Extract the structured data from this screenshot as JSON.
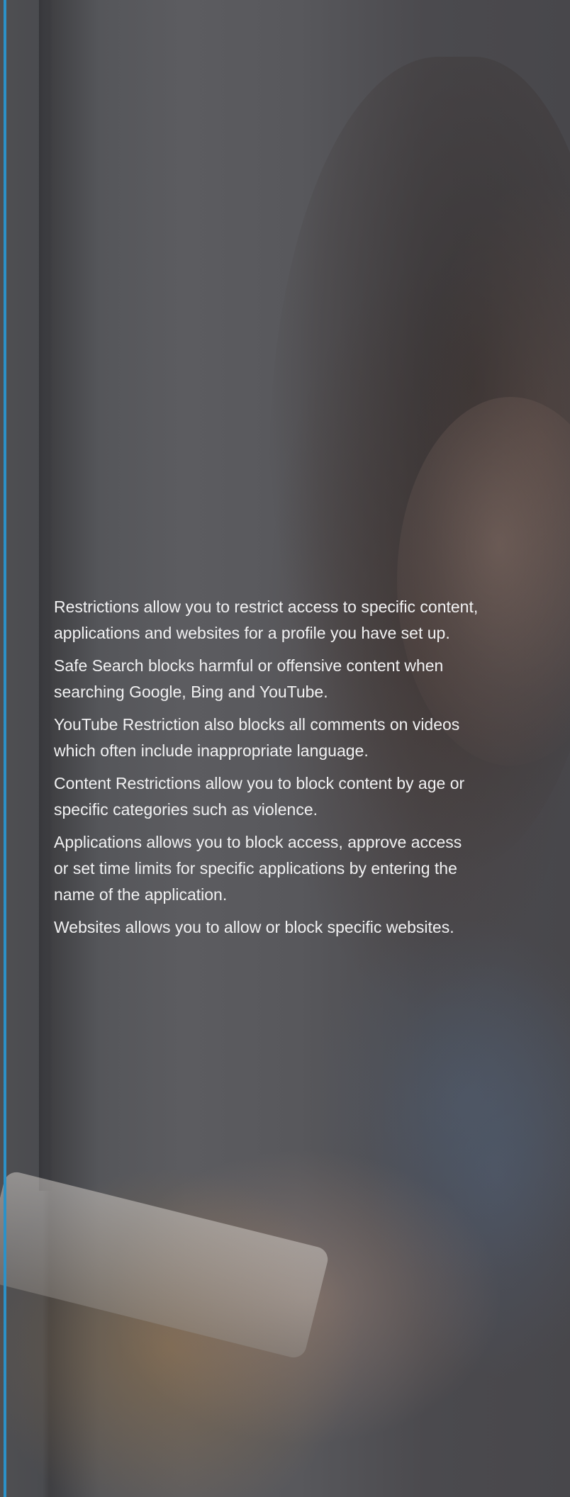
{
  "theme": {
    "accent_color": "#2c91c8",
    "text_color": "#f1f1f2",
    "overlay_color": "#4a4a4d"
  },
  "background": {
    "image": "woman-smiling-using-smartphone-photo"
  },
  "content": {
    "paragraphs": [
      "Restrictions allow you to restrict access to specific content, applications and websites for a profile you have set up.",
      "Safe Search blocks harmful or offensive content when searching Google, Bing and YouTube.",
      "YouTube Restriction also blocks all comments on videos which often include inappropriate language.",
      "Content Restrictions allow you to block content by age or specific categories such as violence.",
      "Applications allows you to block access, approve access or set time limits for specific applications by entering the name of the application.",
      "Websites allows you to allow or block specific websites."
    ]
  }
}
